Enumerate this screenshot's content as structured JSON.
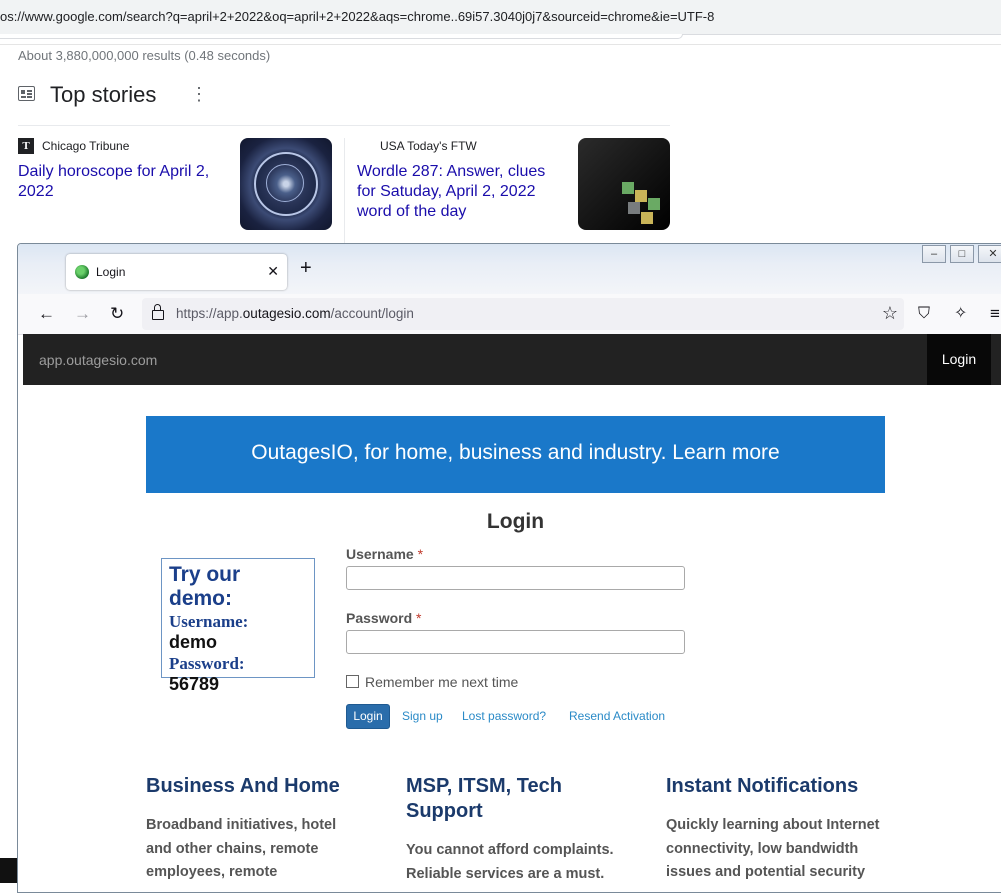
{
  "google": {
    "url": "os://www.google.com/search?q=april+2+2022&oq=april+2+2022&aqs=chrome..69i57.3040j0j7&sourceid=chrome&ie=UTF-8",
    "results_stats": "About 3,880,000,000 results (0.48 seconds)",
    "top_stories_title": "Top stories",
    "stories": [
      {
        "source_icon_letter": "T",
        "source": "Chicago Tribune",
        "title_line1": "Daily horoscope for April 2,",
        "title_line2": "2022"
      },
      {
        "source": "USA Today's FTW",
        "title_line1": "Wordle 287: Answer, clues",
        "title_line2": "for Satuday, April 2, 2022",
        "title_line3": "word of the day"
      }
    ]
  },
  "firefox": {
    "tab_label": "Login",
    "url_prefix": "https://app.",
    "url_domain": "outagesio.com",
    "url_path": "/account/login"
  },
  "site": {
    "brand": "app.outagesio.com",
    "nav_login": "Login",
    "banner": "OutagesIO, for home, business and industry. Learn more",
    "heading": "Login",
    "demo": {
      "heading": "Try our demo:",
      "username_label": "Username:",
      "username": "demo",
      "password_label": "Password:",
      "password": "56789"
    },
    "form": {
      "username_label": "Username",
      "password_label": "Password",
      "required_mark": "*",
      "username_value": "",
      "password_value": "",
      "remember": "Remember me next time",
      "login_button": "Login",
      "links": [
        "Sign up",
        "Lost password?",
        "Resend Activation"
      ]
    },
    "features": [
      {
        "title_line1": "Business And Home",
        "title_line2": "",
        "text": [
          "Broadband initiatives, hotel",
          "and other chains, remote",
          "employees, remote"
        ]
      },
      {
        "title_line1": "MSP, ITSM, Tech",
        "title_line2": "Support",
        "text": [
          "You cannot afford complaints.",
          "Reliable services are a must."
        ]
      },
      {
        "title_line1": "Instant Notifications",
        "title_line2": "",
        "text": [
          "Quickly learning about Internet",
          "connectivity, low bandwidth",
          "issues and potential security"
        ]
      }
    ]
  },
  "colors": {
    "banner": "#1a78c9",
    "navbar": "#222222",
    "link_blue": "#1a0dab",
    "feature_title": "#1b3a6b"
  },
  "icons": [
    "newspaper-icon",
    "more-vert-icon",
    "back-arrow-icon",
    "forward-arrow-icon",
    "reload-icon",
    "lock-icon",
    "star-icon",
    "shield-icon",
    "wand-icon",
    "menu-icon",
    "close-icon",
    "plus-icon"
  ]
}
